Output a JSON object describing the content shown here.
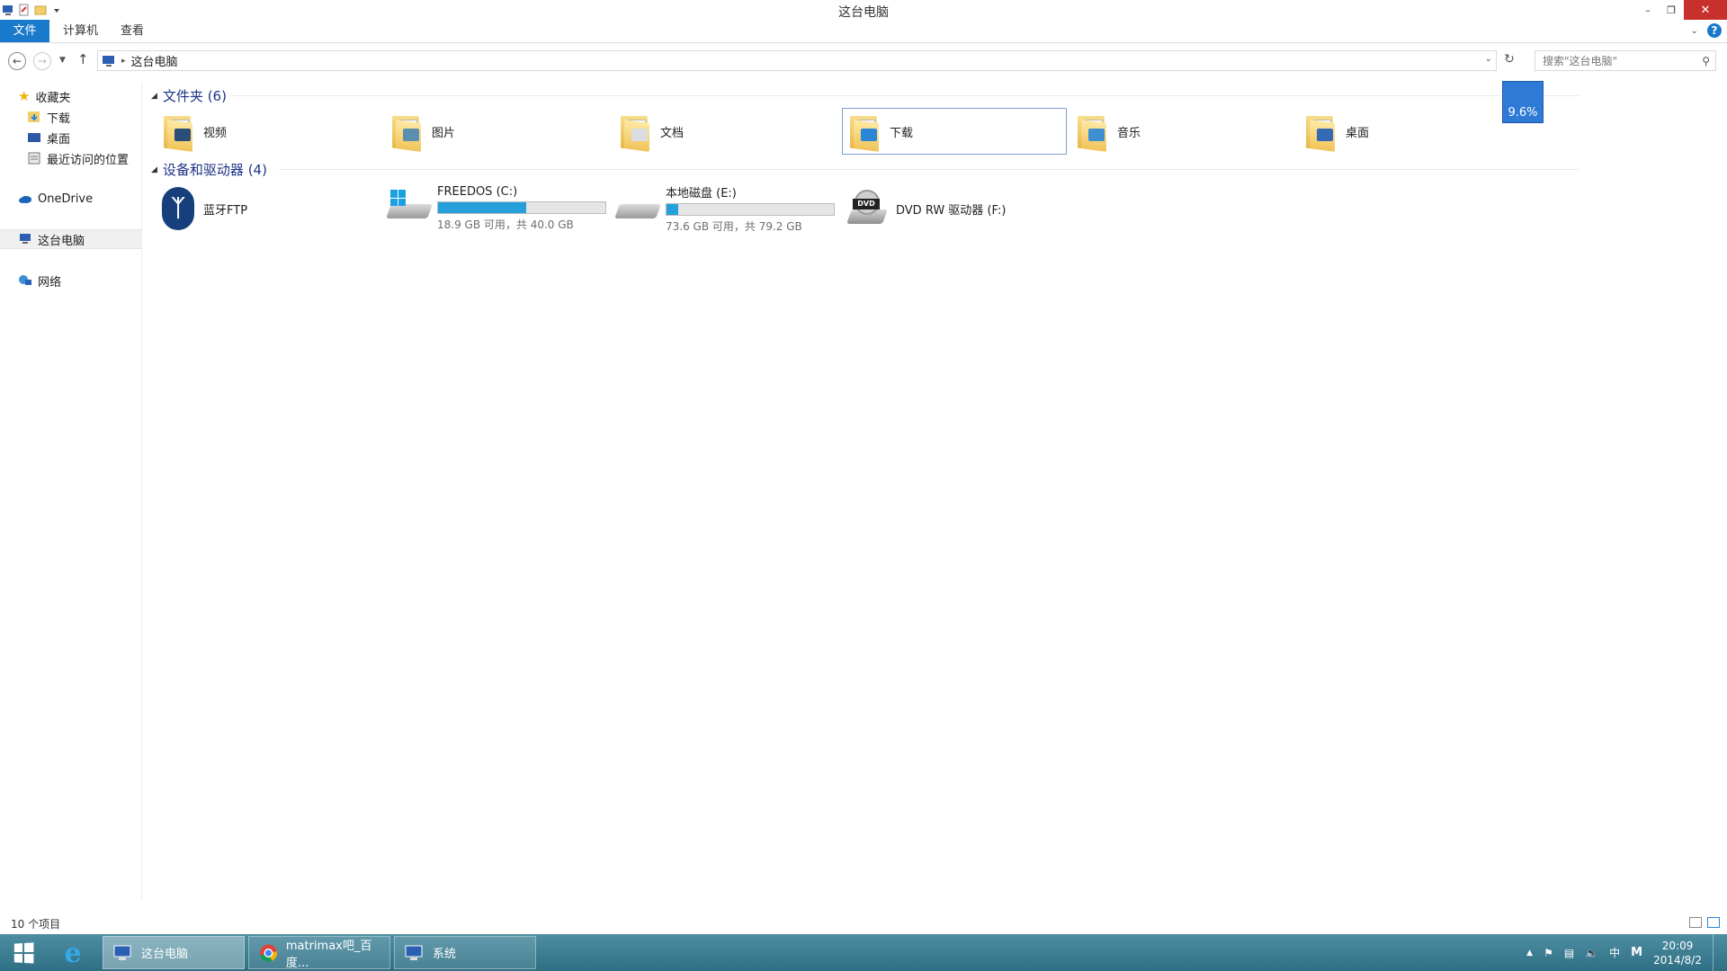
{
  "window": {
    "title": "这台电脑",
    "minimize": "–",
    "restore": "❐",
    "close": "✕"
  },
  "ribbon": {
    "tabs": [
      "文件",
      "计算机",
      "查看"
    ],
    "help": "?"
  },
  "address": {
    "path": "这台电脑",
    "search_placeholder": "搜索\"这台电脑\""
  },
  "nav": {
    "favorites": "收藏夹",
    "downloads": "下载",
    "desktop": "桌面",
    "recent": "最近访问的位置",
    "onedrive": "OneDrive",
    "this_pc": "这台电脑",
    "network": "网络"
  },
  "folders_group": "文件夹 (6)",
  "folders": [
    {
      "name": "视频",
      "badge_color": "#2b4d7a"
    },
    {
      "name": "图片",
      "badge_color": "#5b8fb0"
    },
    {
      "name": "文档",
      "badge_color": "#d9dde2"
    },
    {
      "name": "下载",
      "badge_color": "#2a86d8"
    },
    {
      "name": "音乐",
      "badge_color": "#3d8fd1"
    },
    {
      "name": "桌面",
      "badge_color": "#3569b5"
    }
  ],
  "devices_group": "设备和驱动器 (4)",
  "devices": {
    "bluetooth": "蓝牙FTP",
    "c": {
      "name": "FREEDOS (C:)",
      "free": "18.9 GB 可用，共 40.0 GB",
      "used_fraction": 0.5275
    },
    "e": {
      "name": "本地磁盘 (E:)",
      "free": "73.6 GB 可用，共 79.2 GB",
      "used_fraction": 0.0707
    },
    "dvd": {
      "name": "DVD RW 驱动器 (F:)",
      "label": "DVD"
    }
  },
  "meter": "9.6%",
  "status": "10 个项目",
  "taskbar": {
    "explorer": "这台电脑",
    "chrome": "matrimax吧_百度...",
    "system": "系统",
    "ime": "中",
    "ime2": "M",
    "time": "20:09",
    "date": "2014/8/2"
  }
}
